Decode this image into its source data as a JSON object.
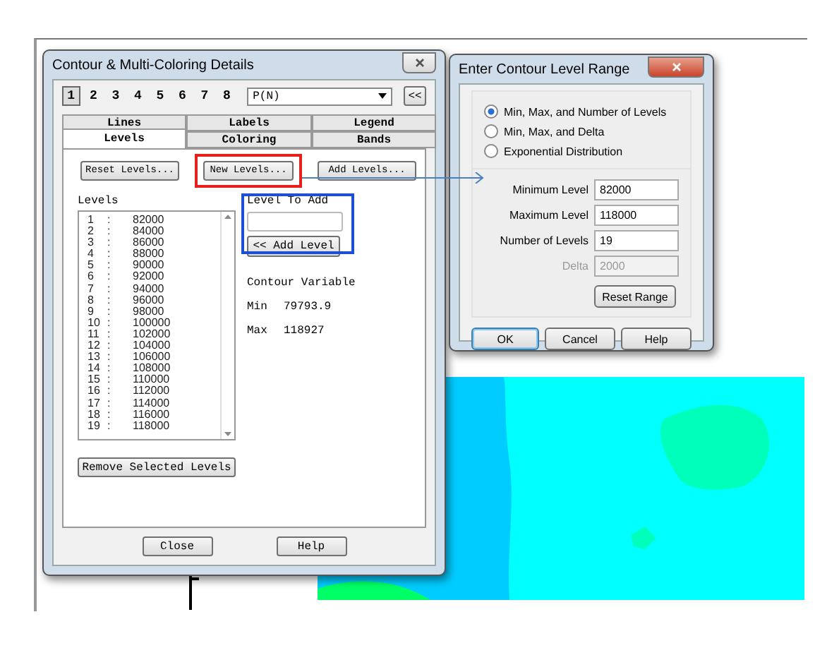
{
  "left_dialog": {
    "title": "Contour & Multi-Coloring Details",
    "frame_tabs": [
      {
        "label": "1",
        "selected": true
      },
      {
        "label": "2",
        "selected": false
      },
      {
        "label": "3",
        "selected": false
      },
      {
        "label": "4",
        "selected": false
      },
      {
        "label": "5",
        "selected": false
      },
      {
        "label": "6",
        "selected": false
      },
      {
        "label": "7",
        "selected": false
      },
      {
        "label": "8",
        "selected": false
      }
    ],
    "variable_select": {
      "value": "P(N)"
    },
    "collapse_button": "<<",
    "tabs_back": [
      {
        "label": "Lines",
        "selected": false
      },
      {
        "label": "Labels",
        "selected": false
      },
      {
        "label": "Legend",
        "selected": false
      }
    ],
    "tabs_front": [
      {
        "label": "Levels",
        "selected": true
      },
      {
        "label": "Coloring",
        "selected": false
      },
      {
        "label": "Bands",
        "selected": false
      }
    ],
    "action_buttons": [
      {
        "label": "Reset Levels...",
        "highlighted": false
      },
      {
        "label": "New Levels...",
        "highlighted": true
      },
      {
        "label": "Add Levels...",
        "highlighted": false
      }
    ],
    "levels_label": "Levels",
    "levels": [
      {
        "number": "1",
        "separator": ":",
        "value": "82000"
      },
      {
        "number": "2",
        "separator": ":",
        "value": "84000"
      },
      {
        "number": "3",
        "separator": ":",
        "value": "86000"
      },
      {
        "number": "4",
        "separator": ":",
        "value": "88000"
      },
      {
        "number": "5",
        "separator": ":",
        "value": "90000"
      },
      {
        "number": "6",
        "separator": ":",
        "value": "92000"
      },
      {
        "number": "7",
        "separator": ":",
        "value": "94000"
      },
      {
        "number": "8",
        "separator": ":",
        "value": "96000"
      },
      {
        "number": "9",
        "separator": ":",
        "value": "98000"
      },
      {
        "number": "10",
        "separator": ":",
        "value": "100000"
      },
      {
        "number": "11",
        "separator": ":",
        "value": "102000"
      },
      {
        "number": "12",
        "separator": ":",
        "value": "104000"
      },
      {
        "number": "13",
        "separator": ":",
        "value": "106000"
      },
      {
        "number": "14",
        "separator": ":",
        "value": "108000"
      },
      {
        "number": "15",
        "separator": ":",
        "value": "110000"
      },
      {
        "number": "16",
        "separator": ":",
        "value": "112000"
      },
      {
        "number": "17",
        "separator": ":",
        "value": "114000"
      },
      {
        "number": "18",
        "separator": ":",
        "value": "116000"
      },
      {
        "number": "19",
        "separator": ":",
        "value": "118000"
      }
    ],
    "level_to_add": {
      "label": "Level To Add",
      "button": "<< Add Level",
      "highlighted": true
    },
    "contour_variable": {
      "heading": "Contour Variable",
      "min_label": "Min",
      "min_value": "79793.9",
      "max_label": "Max",
      "max_value": "118927"
    },
    "remove_button": "Remove Selected Levels",
    "footer_buttons": [
      "Close",
      "Help"
    ]
  },
  "right_dialog": {
    "title": "Enter Contour Level Range",
    "options": [
      {
        "label": "Min, Max, and Number of Levels",
        "selected": true
      },
      {
        "label": "Min, Max, and Delta",
        "selected": false
      },
      {
        "label": "Exponential Distribution",
        "selected": false
      }
    ],
    "fields": [
      {
        "label": "Minimum Level",
        "value": "82000",
        "disabled": false
      },
      {
        "label": "Maximum Level",
        "value": "118000",
        "disabled": false
      },
      {
        "label": "Number of Levels",
        "value": "19",
        "disabled": false
      },
      {
        "label": "Delta",
        "value": "2000",
        "disabled": true
      }
    ],
    "reset_button": "Reset Range",
    "buttons": [
      {
        "label": "OK",
        "default": true
      },
      {
        "label": "Cancel",
        "default": false
      },
      {
        "label": "Help",
        "default": false
      }
    ]
  }
}
